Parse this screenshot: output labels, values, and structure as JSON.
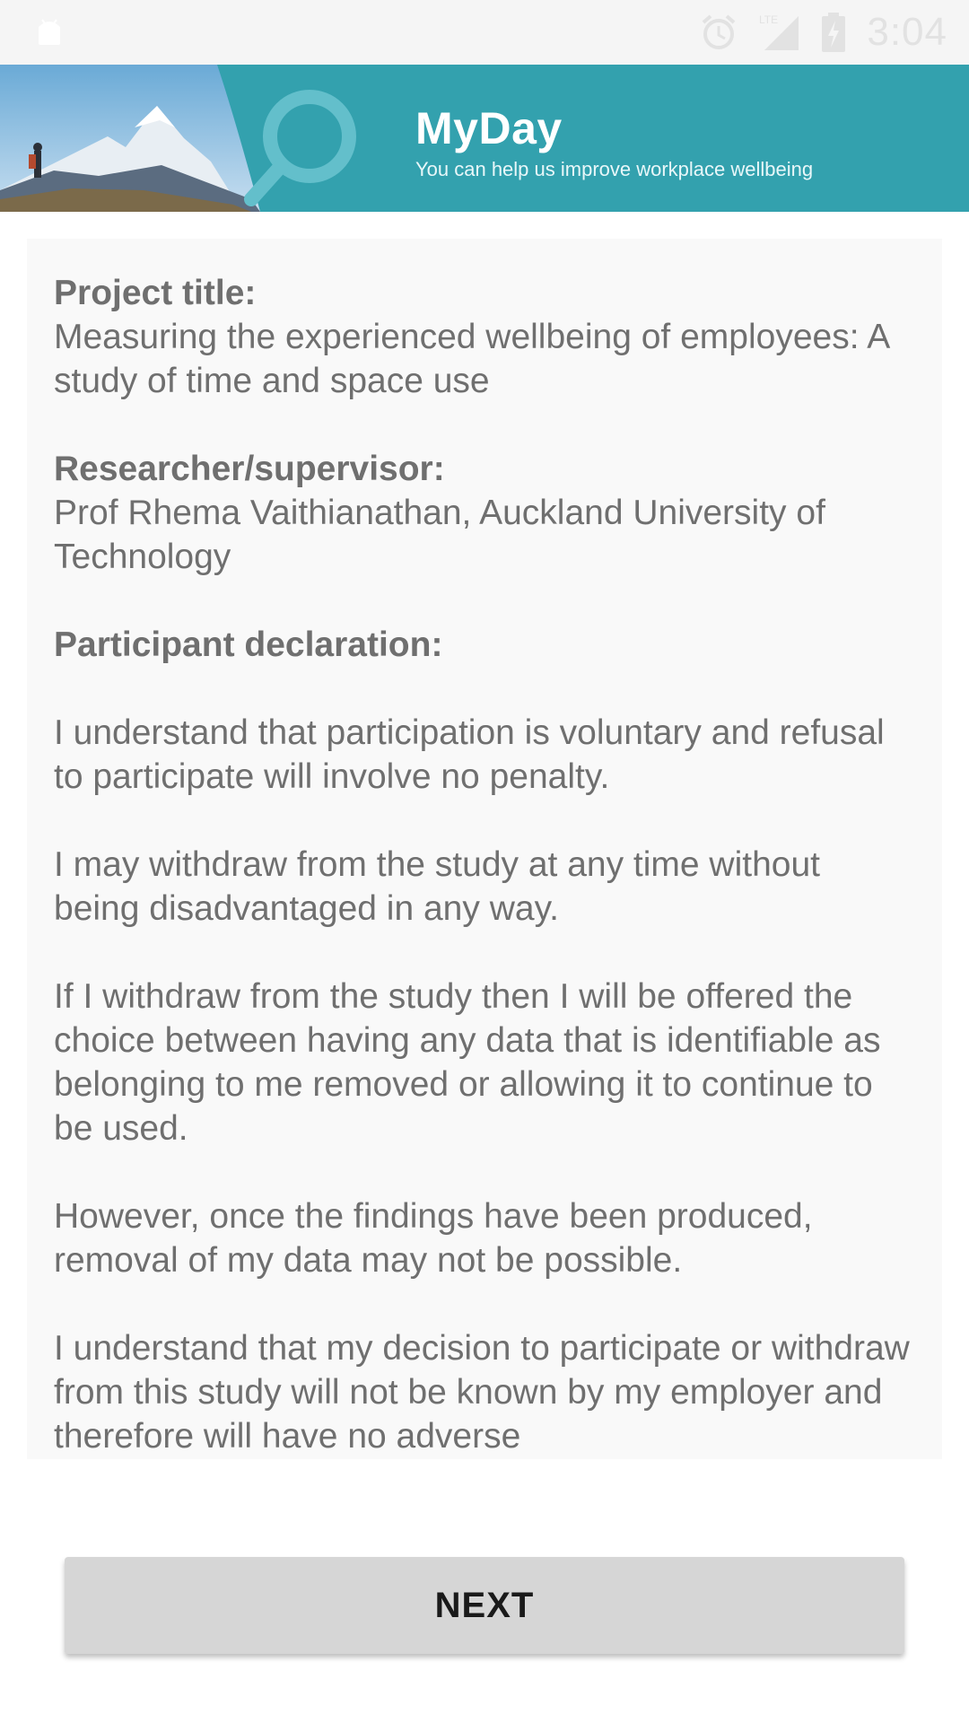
{
  "status_bar": {
    "time": "3:04",
    "network_label": "LTE",
    "icons": [
      "android-icon",
      "alarm-icon",
      "signal-icon",
      "battery-charging-icon"
    ]
  },
  "banner": {
    "title": "MyDay",
    "subtitle": "You can help us improve workplace wellbeing",
    "colors": {
      "background": "#33a1ae",
      "text": "#ffffff"
    }
  },
  "content": {
    "project_title_label": "Project title:",
    "project_title_value": "Measuring the experienced wellbeing of employees: A study of time and space use",
    "researcher_label": "Researcher/supervisor:",
    "researcher_value": "Prof Rhema Vaithianathan, Auckland University of Technology",
    "declaration_label": "Participant declaration:",
    "paragraphs": [
      "I understand that participation is voluntary and refusal to participate will involve no penalty.",
      "I may withdraw from the study at any time without being disadvantaged in any way.",
      "If I withdraw from the study then I will be offered the choice between having any data that is identifiable as belonging to me removed or allowing it to continue to be used.",
      "However, once the findings have been produced, removal of my data may not be possible.",
      "I understand that my decision to participate or withdraw from this study will not be known by my employer and therefore will have no adverse"
    ]
  },
  "next_button": {
    "label": "NEXT"
  }
}
